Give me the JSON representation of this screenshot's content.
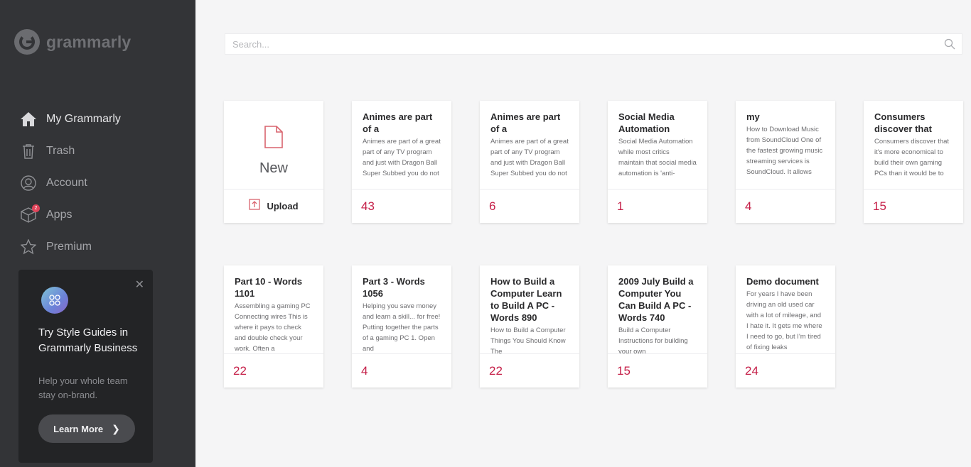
{
  "brand": {
    "name": "grammarly"
  },
  "nav": [
    {
      "label": "My Grammarly",
      "icon": "home-icon",
      "active": true
    },
    {
      "label": "Trash",
      "icon": "trash-icon"
    },
    {
      "label": "Account",
      "icon": "account-icon"
    },
    {
      "label": "Apps",
      "icon": "apps-icon",
      "badge": "2"
    },
    {
      "label": "Premium",
      "icon": "star-icon"
    }
  ],
  "promo": {
    "title": "Try Style Guides in Grammarly Business",
    "subtitle": "Help your whole team stay on-brand.",
    "button": "Learn More"
  },
  "search": {
    "placeholder": "Search..."
  },
  "new_card": {
    "new_label": "New",
    "upload_label": "Upload"
  },
  "documents": [
    {
      "title": "Animes are part of a",
      "excerpt": "Animes are part of a great part of any TV program and just with Dragon Ball Super Subbed you do not",
      "count": "43"
    },
    {
      "title": "Animes are part of a",
      "excerpt": "Animes are part of a great part of any TV program and just with Dragon Ball Super Subbed you do not",
      "count": "6"
    },
    {
      "title": "Social Media Automation",
      "excerpt": "Social Media Automation while most critics maintain that social media automation is 'anti-",
      "count": "1"
    },
    {
      "title": "my",
      "excerpt": "How to Download Music from SoundCloud One of the fastest growing music streaming services is SoundCloud. It allows",
      "count": "4"
    },
    {
      "title": "Consumers discover that",
      "excerpt": "Consumers discover that it's more economical to build their own gaming PCs than it would be to",
      "count": "15"
    },
    {
      "title": "Part 10 - Words 1101",
      "excerpt": "Assembling a gaming PC Connecting wires This is where it pays to check and double check your work. Often a",
      "count": "22"
    },
    {
      "title": "Part 3 - Words 1056",
      "excerpt": " Helping you save money and learn a skill... for free! Putting together the parts of a gaming PC 1. Open and",
      "count": "4"
    },
    {
      "title": "How to Build a Computer Learn to Build A PC - Words 890",
      "excerpt": "How to Build a Computer Things You Should Know    The",
      "count": "22"
    },
    {
      "title": "2009 July Build a Computer You Can Build A PC - Words 740",
      "excerpt": "Build a Computer Instructions for building your own",
      "count": "15"
    },
    {
      "title": "Demo document",
      "excerpt": "For years I have been driving an old used car with a lot of mileage, and I hate it. It gets me where I need to go, but I'm tired of fixing leaks",
      "count": "24"
    }
  ],
  "colors": {
    "sidebar": "#333437",
    "accent": "#c51f48",
    "background": "#f5f5f6"
  }
}
